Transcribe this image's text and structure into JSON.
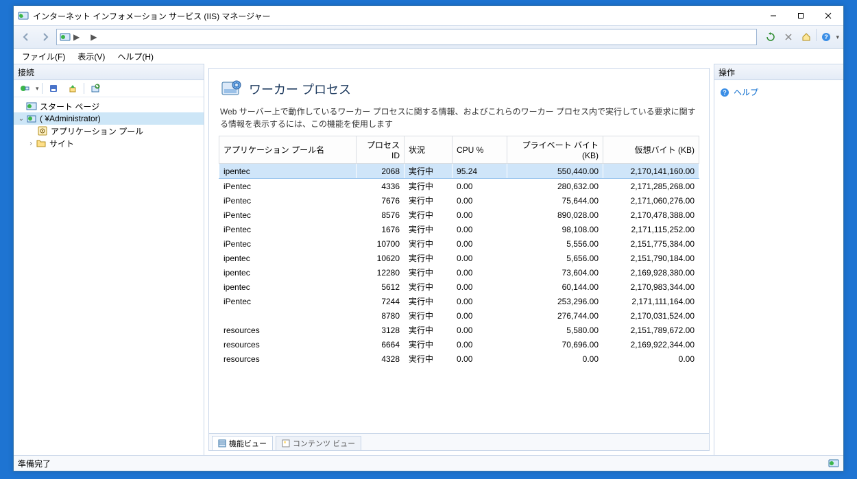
{
  "window": {
    "title": "インターネット インフォメーション サービス (IIS) マネージャー"
  },
  "address": {
    "root_label": "",
    "arrow": "▶"
  },
  "menu": {
    "file": "ファイル(F)",
    "view": "表示(V)",
    "help": "ヘルプ(H)"
  },
  "panes": {
    "connections": "接続",
    "actions": "操作"
  },
  "tree": {
    "start": "スタート ページ",
    "server": "(                  ¥Administrator)",
    "app_pools": "アプリケーション プール",
    "sites": "サイト"
  },
  "page": {
    "title": "ワーカー プロセス",
    "description": "Web サーバー上で動作しているワーカー プロセスに関する情報、およびこれらのワーカー プロセス内で実行している要求に関する情報を表示するには、この機能を使用します"
  },
  "columns": {
    "name": "アプリケーション プール名",
    "pid": "プロセス ID",
    "state": "状況",
    "cpu": "CPU %",
    "private": "プライベート バイト (KB)",
    "virtual": "仮想バイト (KB)"
  },
  "rows": [
    {
      "name": "ipentec",
      "pid": "2068",
      "state": "実行中",
      "cpu": "95.24",
      "private": "550,440.00",
      "virtual": "2,170,141,160.00",
      "selected": true
    },
    {
      "name": "iPentec",
      "pid": "4336",
      "state": "実行中",
      "cpu": "0.00",
      "private": "280,632.00",
      "virtual": "2,171,285,268.00"
    },
    {
      "name": "iPentec",
      "pid": "7676",
      "state": "実行中",
      "cpu": "0.00",
      "private": "75,644.00",
      "virtual": "2,171,060,276.00"
    },
    {
      "name": "iPentec",
      "pid": "8576",
      "state": "実行中",
      "cpu": "0.00",
      "private": "890,028.00",
      "virtual": "2,170,478,388.00"
    },
    {
      "name": "iPentec",
      "pid": "1676",
      "state": "実行中",
      "cpu": "0.00",
      "private": "98,108.00",
      "virtual": "2,171,115,252.00"
    },
    {
      "name": "iPentec",
      "pid": "10700",
      "state": "実行中",
      "cpu": "0.00",
      "private": "5,556.00",
      "virtual": "2,151,775,384.00"
    },
    {
      "name": "ipentec",
      "pid": "10620",
      "state": "実行中",
      "cpu": "0.00",
      "private": "5,656.00",
      "virtual": "2,151,790,184.00"
    },
    {
      "name": "ipentec",
      "pid": "12280",
      "state": "実行中",
      "cpu": "0.00",
      "private": "73,604.00",
      "virtual": "2,169,928,380.00"
    },
    {
      "name": "ipentec",
      "pid": "5612",
      "state": "実行中",
      "cpu": "0.00",
      "private": "60,144.00",
      "virtual": "2,170,983,344.00"
    },
    {
      "name": "iPentec",
      "pid": "7244",
      "state": "実行中",
      "cpu": "0.00",
      "private": "253,296.00",
      "virtual": "2,171,111,164.00"
    },
    {
      "name": "",
      "pid": "8780",
      "state": "実行中",
      "cpu": "0.00",
      "private": "276,744.00",
      "virtual": "2,170,031,524.00"
    },
    {
      "name": "resources",
      "pid": "3128",
      "state": "実行中",
      "cpu": "0.00",
      "private": "5,580.00",
      "virtual": "2,151,789,672.00"
    },
    {
      "name": "resources",
      "pid": "6664",
      "state": "実行中",
      "cpu": "0.00",
      "private": "70,696.00",
      "virtual": "2,169,922,344.00"
    },
    {
      "name": "resources",
      "pid": "4328",
      "state": "実行中",
      "cpu": "0.00",
      "private": "0.00",
      "virtual": "0.00"
    }
  ],
  "tabs": {
    "features": "機能ビュー",
    "content": "コンテンツ ビュー"
  },
  "actions_pane": {
    "help": "ヘルプ"
  },
  "status": {
    "ready": "準備完了"
  }
}
